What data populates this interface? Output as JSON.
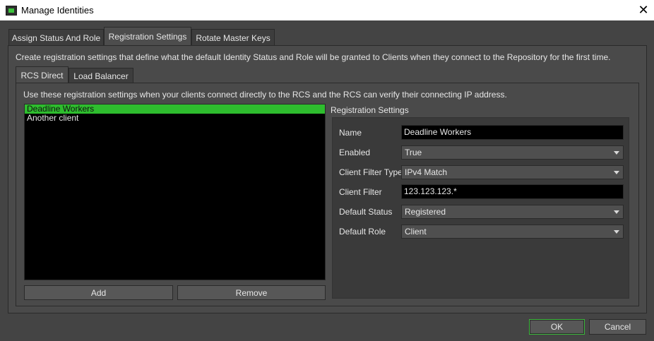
{
  "window": {
    "title": "Manage Identities",
    "close_symbol": "✕"
  },
  "main_tabs": [
    {
      "label": "Assign Status And Role"
    },
    {
      "label": "Registration Settings"
    },
    {
      "label": "Rotate Master Keys"
    }
  ],
  "main_description": "Create registration settings that define what the default Identity Status and Role will be granted to Clients when they connect to the Repository for the first time.",
  "sub_tabs": [
    {
      "label": "RCS Direct"
    },
    {
      "label": "Load Balancer"
    }
  ],
  "sub_description": "Use these registration settings when your clients connect directly to the RCS and the RCS can verify their connecting IP address.",
  "clients": [
    {
      "label": "Deadline Workers",
      "selected": true
    },
    {
      "label": "Another client",
      "selected": false
    }
  ],
  "list_buttons": {
    "add": "Add",
    "remove": "Remove"
  },
  "settings": {
    "group_title": "Registration Settings",
    "name": {
      "label": "Name",
      "value": "Deadline Workers"
    },
    "enabled": {
      "label": "Enabled",
      "value": "True"
    },
    "client_filter_type": {
      "label": "Client Filter Type",
      "value": "IPv4 Match"
    },
    "client_filter": {
      "label": "Client Filter",
      "value": "123.123.123.*"
    },
    "default_status": {
      "label": "Default Status",
      "value": "Registered"
    },
    "default_role": {
      "label": "Default Role",
      "value": "Client"
    }
  },
  "dialog_buttons": {
    "ok": "OK",
    "cancel": "Cancel"
  },
  "colors": {
    "accent": "#2ebd2e",
    "background": "#444444",
    "input_bg": "#000000"
  }
}
